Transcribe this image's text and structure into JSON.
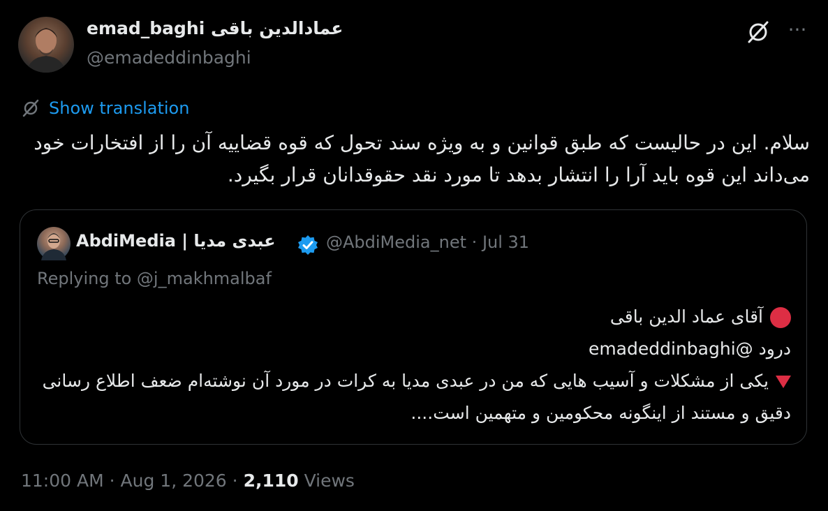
{
  "author": {
    "display_name": "emad_baghi عمادالدین باقی",
    "handle": "@emadeddinbaghi"
  },
  "icons": {
    "grok": "grok-slash-icon",
    "more": "more-icon",
    "translate": "translate-icon",
    "verified": "verified-badge-icon",
    "red_circle": "red-circle-emoji",
    "red_triangle": "red-triangle-emoji"
  },
  "colors": {
    "background": "#000000",
    "text": "#e7e9ea",
    "muted": "#71767b",
    "link": "#1d9bf0",
    "border": "#2f3336",
    "emoji_red": "#dd2e44"
  },
  "more_glyph": "···",
  "show_translation": "Show translation",
  "tweet_text": "سلام. این در حالیست که طبق قوانین و به ویژه سند تحول که قوه قضاییه آن را از افتخارات خود می‌داند این قوه باید آرا را انتشار بدهد تا مورد نقد حقوقدانان قرار بگیرد.",
  "quote": {
    "display_name": "AbdiMedia | عبدی مدیا",
    "handle": "@AbdiMedia_net",
    "separator": "·",
    "date": "Jul 31",
    "replying_to": "Replying to @j_makhmalbaf",
    "line1": "آقای عماد الدین باقی",
    "line2": "درود @emadeddinbaghi",
    "line3": "یکی از مشکلات و آسیب هایی که من در عبدی مدیا به کرات در مورد آن نوشته‌ام ضعف اطلاع رسانی دقیق و مستند از اینگونه محکومین و متهمین است...."
  },
  "footer": {
    "time": "11:00 AM",
    "separator": "·",
    "date": "Aug 1, 2026",
    "views_count": "2,110",
    "views_label": "Views"
  }
}
